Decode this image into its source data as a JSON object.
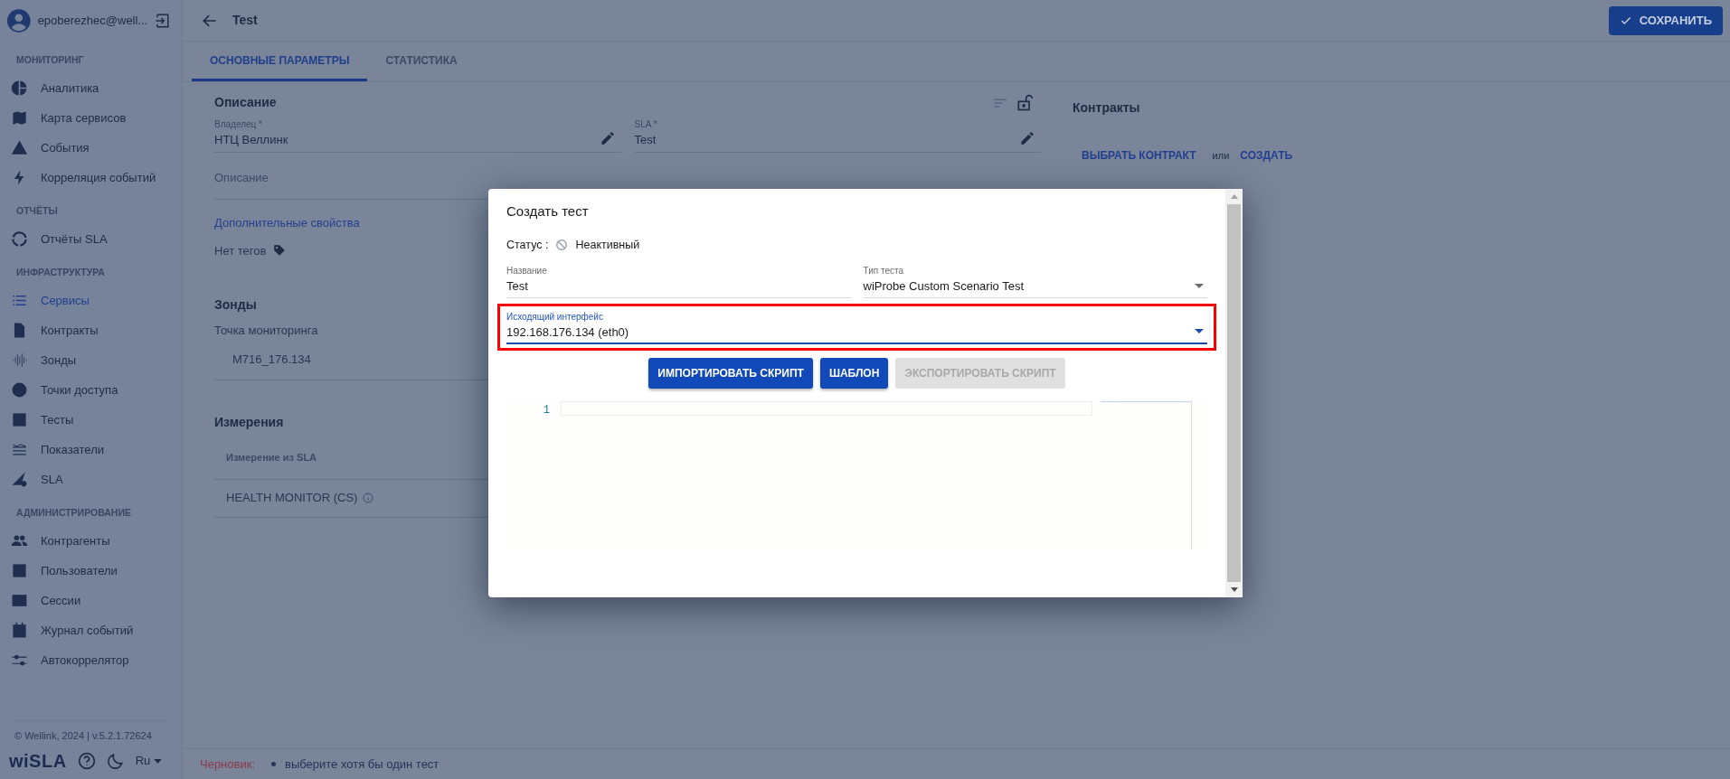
{
  "sidebar": {
    "user": "epoberezhec@well...",
    "sections": [
      {
        "title": "МОНИТОРИНГ",
        "items": [
          {
            "label": "Аналитика",
            "selected": false
          },
          {
            "label": "Карта сервисов",
            "selected": false
          },
          {
            "label": "События",
            "selected": false
          },
          {
            "label": "Корреляция событий",
            "selected": false
          }
        ]
      },
      {
        "title": "ОТЧЁТЫ",
        "items": [
          {
            "label": "Отчёты SLA",
            "selected": false
          }
        ]
      },
      {
        "title": "ИНФРАСТРУКТУРА",
        "items": [
          {
            "label": "Сервисы",
            "selected": true
          },
          {
            "label": "Контракты",
            "selected": false
          },
          {
            "label": "Зонды",
            "selected": false
          },
          {
            "label": "Точки доступа",
            "selected": false
          },
          {
            "label": "Тесты",
            "selected": false
          },
          {
            "label": "Показатели",
            "selected": false
          },
          {
            "label": "SLA",
            "selected": false
          }
        ]
      },
      {
        "title": "АДМИНИСТРИРОВАНИЕ",
        "items": [
          {
            "label": "Контрагенты",
            "selected": false
          },
          {
            "label": "Пользователи",
            "selected": false
          },
          {
            "label": "Сессии",
            "selected": false
          },
          {
            "label": "Журнал событий",
            "selected": false
          },
          {
            "label": "Автокоррелятор",
            "selected": false
          }
        ]
      }
    ],
    "copyright": "© Wellink, 2024 | v.5.2.1.72624",
    "logo": "wiSLA",
    "language": "Ru"
  },
  "header": {
    "title": "Test",
    "save_button": "СОХРАНИТЬ"
  },
  "tabs": [
    {
      "label": "ОСНОВНЫЕ ПАРАМЕТРЫ",
      "selected": true
    },
    {
      "label": "СТАТИСТИКА",
      "selected": false
    }
  ],
  "description": {
    "heading": "Описание",
    "owner": {
      "label": "Владелец *",
      "value": "НТЦ Веллинк"
    },
    "sla": {
      "label": "SLA *",
      "value": "Test"
    },
    "description_placeholder": "Описание",
    "more_link": "Дополнительные свойства",
    "tags": "Нет тегов"
  },
  "probes": {
    "heading": "Зонды",
    "label": "Точка мониторинга",
    "value": "M716_176.134"
  },
  "measurements": {
    "heading": "Измерения",
    "column": "Измерение из SLA",
    "rows": [
      "HEALTH MONITOR (CS)"
    ]
  },
  "contracts": {
    "heading": "Контракты",
    "select": "ВЫБРАТЬ КОНТРАКТ",
    "or": "или",
    "create": "СОЗДАТЬ"
  },
  "status_bar": {
    "label": "Черновик:",
    "messages": [
      "выберите хотя бы один тест"
    ]
  },
  "dialog": {
    "title": "Создать тест",
    "status_label": "Статус :",
    "status": "Неактивный",
    "fields": [
      {
        "label": "Название",
        "value": "Test",
        "kind": "text",
        "focused": false,
        "highlighted": false
      },
      {
        "label": "Тип теста",
        "value": "wiProbe Custom Scenario Test",
        "kind": "select",
        "focused": false,
        "highlighted": false
      },
      {
        "label": "Исходящий интерфейс",
        "value": "192.168.176.134 (eth0)",
        "kind": "select",
        "focused": true,
        "highlighted": true
      }
    ],
    "buttons": [
      {
        "label": "ИМПОРТИРОВАТЬ СКРИПТ",
        "disabled": false
      },
      {
        "label": "ШАБЛОН",
        "disabled": false
      },
      {
        "label": "ЭКСПОРТИРОВАТЬ СКРИПТ",
        "disabled": true
      }
    ],
    "editor": {
      "line_numbers": [
        "1"
      ]
    }
  }
}
